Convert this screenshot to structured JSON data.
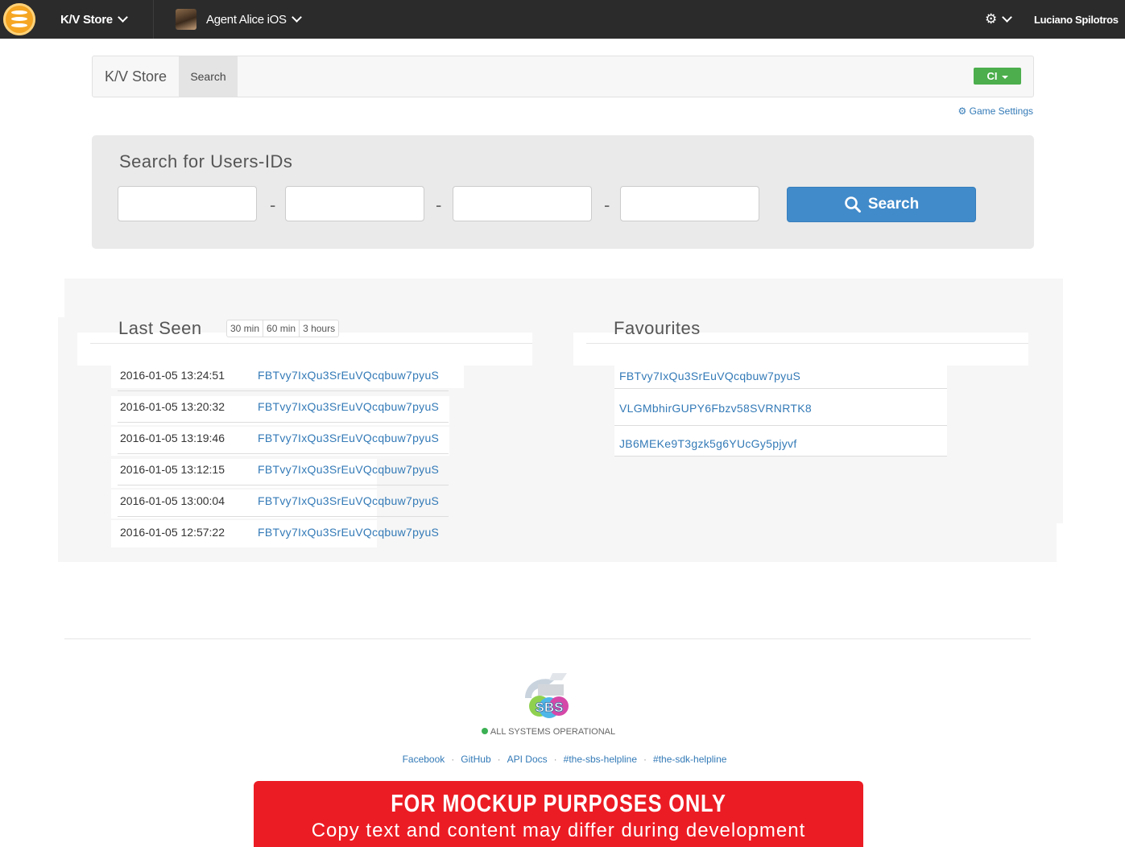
{
  "navbar": {
    "app_menu_label": "K/V Store",
    "game_menu_label": "Agent Alice iOS",
    "user_name": "Luciano Spilotros"
  },
  "breadcrumb": {
    "app": "K/V Store",
    "current": "Search",
    "environment": "CI",
    "game_settings": "Game Settings"
  },
  "search": {
    "title": "Search for Users-IDs",
    "fields": [
      "",
      "",
      "",
      ""
    ],
    "separator": "-",
    "button_label": "Search"
  },
  "last_seen": {
    "title": "Last Seen",
    "ranges": [
      "30 min",
      "60 min",
      "3 hours"
    ],
    "rows": [
      {
        "time": "2016-01-05 13:24:51",
        "user_id": "FBTvy7IxQu3SrEuVQcqbuw7pyuS"
      },
      {
        "time": "2016-01-05 13:20:32",
        "user_id": "FBTvy7IxQu3SrEuVQcqbuw7pyuS"
      },
      {
        "time": "2016-01-05 13:19:46",
        "user_id": "FBTvy7IxQu3SrEuVQcqbuw7pyuS"
      },
      {
        "time": "2016-01-05 13:12:15",
        "user_id": "FBTvy7IxQu3SrEuVQcqbuw7pyuS"
      },
      {
        "time": "2016-01-05 13:00:04",
        "user_id": "FBTvy7IxQu3SrEuVQcqbuw7pyuS"
      },
      {
        "time": "2016-01-05 12:57:22",
        "user_id": "FBTvy7IxQu3SrEuVQcqbuw7pyuS"
      }
    ]
  },
  "favourites": {
    "title": "Favourites",
    "items": [
      "FBTvy7IxQu3SrEuVQcqbuw7pyuS",
      "VLGMbhirGUPY6Fbzv58SVRNRTK8",
      "JB6MEKe9T3gzk5g6YUcGy5pjyvf"
    ]
  },
  "footer": {
    "logo_text": "SBS",
    "status": "ALL SYSTEMS OPERATIONAL",
    "links": [
      "Facebook",
      "GitHub",
      "API Docs",
      "#the-sbs-helpline",
      "#the-sdk-helpline"
    ]
  },
  "banner": {
    "title": "FOR MOCKUP PURPOSES ONLY",
    "subtitle": "Copy text and content may differ during development"
  },
  "colors": {
    "navbar_bg": "#2b2b2b",
    "link": "#337ab7",
    "search_button": "#428bca",
    "env_badge": "#4cae4c",
    "status_ok": "#3cb054",
    "banner": "#ec1c24"
  }
}
